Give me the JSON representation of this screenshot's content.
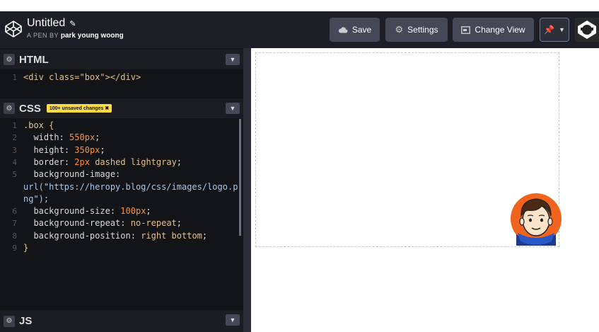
{
  "header": {
    "title": "Untitled",
    "byline_prefix": "A PEN BY",
    "author": "park young woong",
    "buttons": {
      "save": "Save",
      "settings": "Settings",
      "change_view": "Change View"
    }
  },
  "panels": {
    "html": {
      "title": "HTML",
      "code": "<div class=\"box\"></div>"
    },
    "css": {
      "title": "CSS",
      "badge": "100+ unsaved changes",
      "lines": [
        ".box {",
        "  width: 550px;",
        "  height: 350px;",
        "  border: 2px dashed lightgray;",
        "  background-image:",
        "url(\"https://heropy.blog/css/images/logo.p",
        "ng\");",
        "  background-size: 100px;",
        "  background-repeat: no-repeat;",
        "  background-position: right bottom;",
        "}"
      ],
      "line_numbers": [
        "1",
        "2",
        "3",
        "4",
        "5",
        "",
        "",
        "6",
        "7",
        "8",
        "9"
      ]
    },
    "js": {
      "title": "JS"
    }
  },
  "colors": {
    "header_bg": "#1e1f26",
    "editor_bg": "#131417",
    "button_bg": "#444857",
    "badge_bg": "#ffdd40",
    "number_color": "#ff8f36"
  }
}
